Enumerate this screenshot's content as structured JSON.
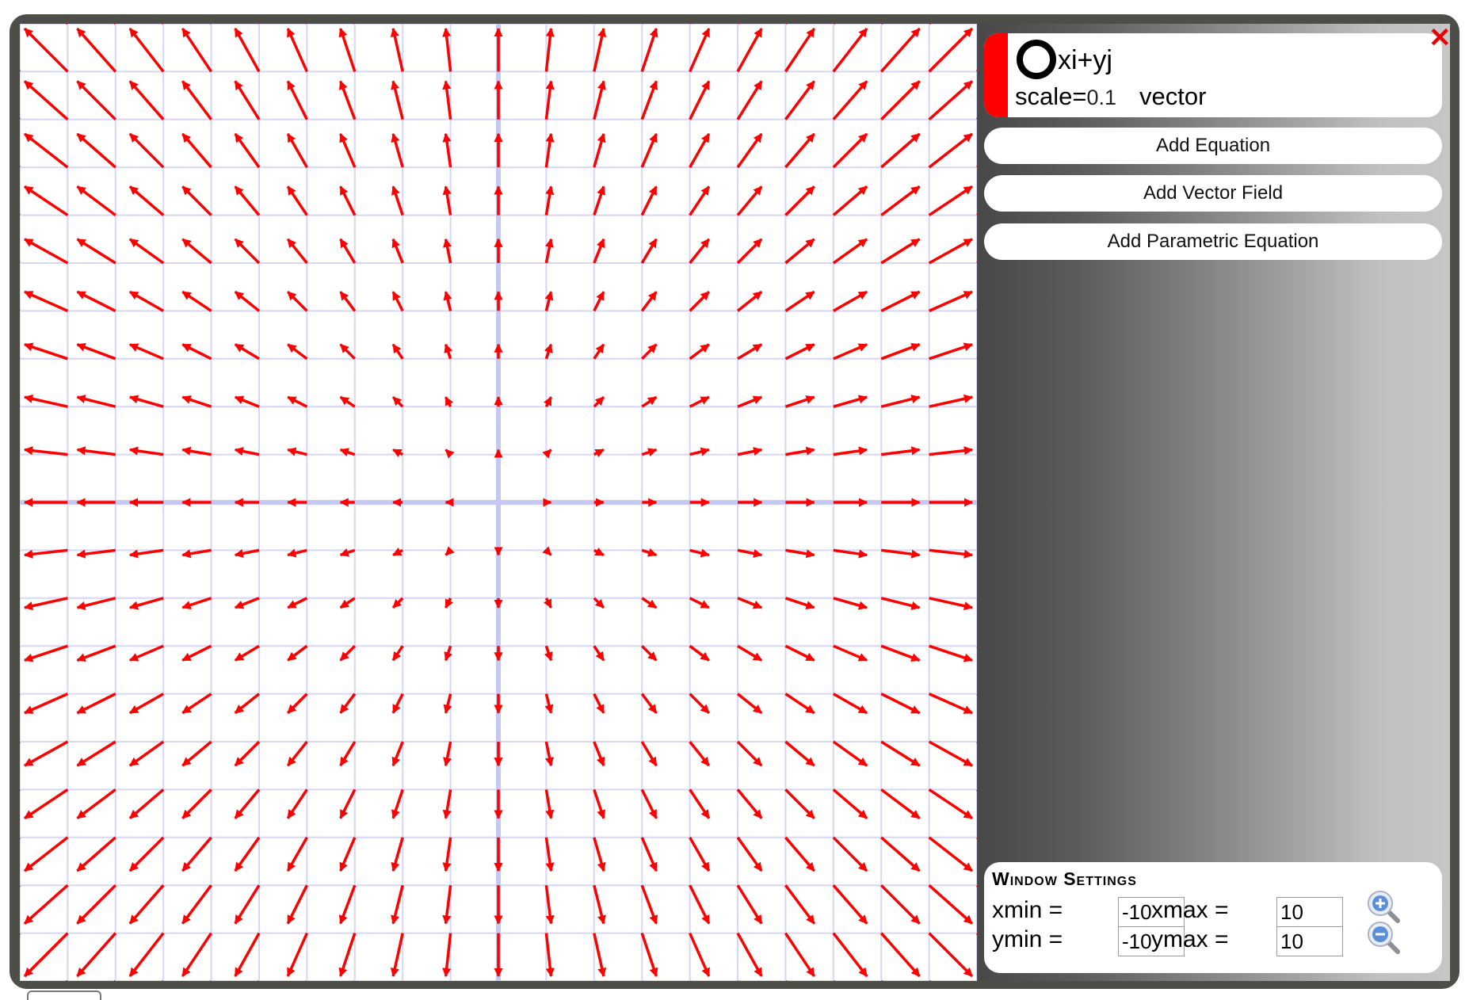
{
  "graph": {
    "window": {
      "xmin": -10,
      "xmax": 10,
      "ymin": -10,
      "ymax": 10
    },
    "grid_step": 1,
    "vector_spacing": 1,
    "grid_color": "#d6d6f6",
    "axis_color": "#c4c8f2",
    "field_color": "#ff0000"
  },
  "expression": {
    "text": "xi+yj",
    "scale_label": "scale=",
    "scale_value": "0.1",
    "type": "vector",
    "color": "#ff0000"
  },
  "buttons": {
    "add_equation": "Add Equation",
    "add_vector_field": "Add Vector Field",
    "add_parametric": "Add Parametric Equation"
  },
  "window_settings": {
    "title": "Window Settings",
    "xmin_label": "xmin =",
    "xmax_label": "xmax =",
    "ymin_label": "ymin =",
    "ymax_label": "ymax =",
    "xmin": "-10",
    "xmax": "10",
    "ymin": "-10",
    "ymax": "10"
  },
  "icons": {
    "zoom_in": "zoom-in-icon",
    "zoom_out": "zoom-out-icon",
    "close": "close-icon",
    "visibility": "visibility-ring-icon"
  }
}
